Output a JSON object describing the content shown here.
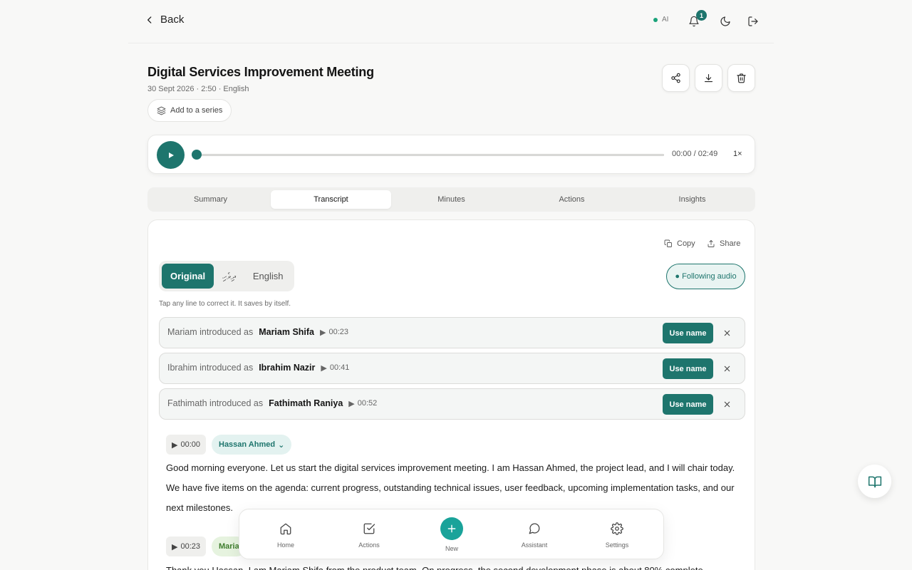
{
  "nav": {
    "back_label": "Back",
    "ai_label": "AI",
    "notification_count": "1"
  },
  "meeting": {
    "title": "Digital Services Improvement Meeting",
    "meta": "30 Sept 2026 · 2:50 · English",
    "add_series_label": "Add to a series"
  },
  "player": {
    "time": "00:00 / 02:49",
    "speed": "1×",
    "progress": 0
  },
  "tabs": [
    {
      "label": "Summary"
    },
    {
      "label": "Transcript",
      "active": true
    },
    {
      "label": "Minutes"
    },
    {
      "label": "Actions"
    },
    {
      "label": "Insights"
    }
  ],
  "transcript": {
    "copy_label": "Copy",
    "share_label": "Share",
    "languages": [
      "Original",
      "ދިވެހި",
      "English"
    ],
    "following_label": "● Following audio",
    "hint": "Tap any line to correct it. It saves by itself.",
    "use_name_label": "Use name",
    "intros": [
      {
        "prefix": "Mariam introduced as",
        "name": "Mariam Shifa",
        "time": "00:23"
      },
      {
        "prefix": "Ibrahim introduced as",
        "name": "Ibrahim Nazir",
        "time": "00:41"
      },
      {
        "prefix": "Fathimath introduced as",
        "name": "Fathimath Raniya",
        "time": "00:52"
      }
    ],
    "utterances": [
      {
        "time": "00:00",
        "speaker": "Hassan Ahmed",
        "text": "Good morning everyone. Let us start the digital services improvement meeting. I am Hassan Ahmed, the project lead, and I will chair today. We have five items on the agenda: current progress, outstanding technical issues, user feedback, upcoming implementation tasks, and our next milestones."
      },
      {
        "time": "00:23",
        "speaker": "Maria",
        "text": "Thank you Hassan. I am Mariam Shifa from the product team. On progress, the second development phase is about 80% complete."
      }
    ]
  },
  "bottom_nav": [
    {
      "label": "Home",
      "icon": "home-icon"
    },
    {
      "label": "Actions",
      "icon": "check-square-icon"
    },
    {
      "label": "New",
      "icon": "plus-icon"
    },
    {
      "label": "Assistant",
      "icon": "chat-bubble-icon"
    },
    {
      "label": "Settings",
      "icon": "gear-icon"
    }
  ],
  "colors": {
    "accent": "#1e756d",
    "fab": "#1aa39a"
  }
}
